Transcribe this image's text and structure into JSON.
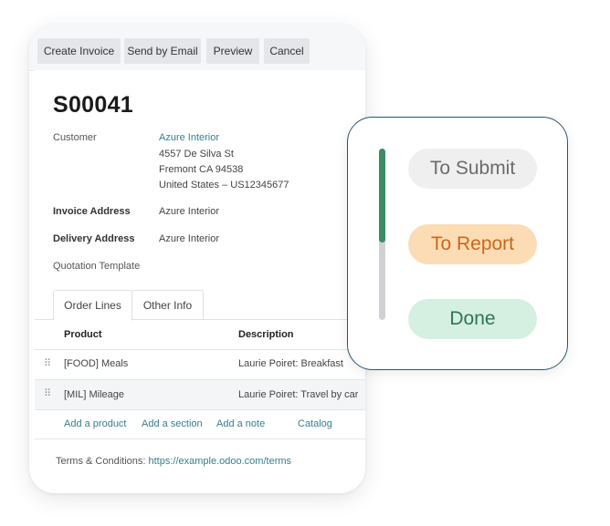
{
  "toolbar": {
    "create_invoice": "Create Invoice",
    "send_by_email": "Send by Email",
    "preview": "Preview",
    "cancel": "Cancel"
  },
  "order": {
    "number": "S00041",
    "customer_label": "Customer",
    "customer_name": "Azure Interior",
    "customer_address": [
      "4557 De Silva St",
      "Fremont CA 94538",
      "United States – US12345677"
    ],
    "invoice_address_label": "Invoice Address",
    "invoice_address": "Azure Interior",
    "delivery_address_label": "Delivery Address",
    "delivery_address": "Azure Interior",
    "quotation_template_label": "Quotation Template"
  },
  "tabs": [
    {
      "label": "Order Lines",
      "active": true
    },
    {
      "label": "Other Info",
      "active": false
    }
  ],
  "table": {
    "columns": [
      "Product",
      "Description"
    ],
    "rows": [
      {
        "product": "[FOOD] Meals",
        "description": "Laurie Poiret: Breakfast"
      },
      {
        "product": "[MIL] Mileage",
        "description": "Laurie Poiret: Travel by car"
      }
    ],
    "actions": [
      "Add a product",
      "Add a section",
      "Add a note",
      "Catalog"
    ]
  },
  "terms": {
    "label": "Terms & Conditions:",
    "url": "https://example.odoo.com/terms"
  },
  "status": {
    "items": [
      "To Submit",
      "To Report",
      "Done"
    ],
    "progress_fraction": 0.55,
    "colors": {
      "to_submit_bg": "#efefef",
      "to_report_bg": "#fcdcb5",
      "done_bg": "#d5f0e0",
      "progress": "#3b8d63",
      "border": "#2b5570",
      "link": "#3a7d8c"
    }
  }
}
